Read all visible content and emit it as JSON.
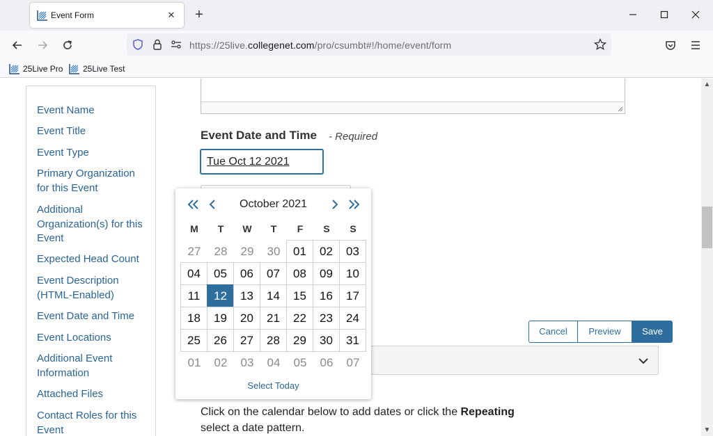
{
  "browser": {
    "tab_title": "Event Form",
    "url_prefix": "https://25live.",
    "url_domain": "collegenet.com",
    "url_path": "/pro/csumbt#!/home/event/form",
    "bookmarks": [
      {
        "label": "25Live Pro"
      },
      {
        "label": "25Live Test"
      }
    ]
  },
  "sidebar": {
    "items": [
      {
        "label": "Event Name"
      },
      {
        "label": "Event Title"
      },
      {
        "label": "Event Type"
      },
      {
        "label": "Primary Organization for this Event"
      },
      {
        "label": "Additional Organization(s) for this Event"
      },
      {
        "label": "Expected Head Count"
      },
      {
        "label": "Event Description (HTML-Enabled)"
      },
      {
        "label": "Event Date and Time"
      },
      {
        "label": "Event Locations"
      },
      {
        "label": "Additional Event Information"
      },
      {
        "label": "Attached Files"
      },
      {
        "label": "Contact Roles for this Event"
      }
    ]
  },
  "form": {
    "section_title": "Event Date and Time",
    "section_required": "- Required",
    "date_value": "Tue Oct 12 2021",
    "instructions_start": "Click on the calendar below to add dates or click the ",
    "instructions_bold": "Repeating",
    "instructions_end": "select a date pattern."
  },
  "actions": {
    "cancel": "Cancel",
    "preview": "Preview",
    "save": "Save"
  },
  "calendar": {
    "month_label": "October 2021",
    "weekdays": [
      "M",
      "T",
      "W",
      "T",
      "F",
      "S",
      "S"
    ],
    "weeks": [
      [
        "27",
        "28",
        "29",
        "30",
        "01",
        "02",
        "03"
      ],
      [
        "04",
        "05",
        "06",
        "07",
        "08",
        "09",
        "10"
      ],
      [
        "11",
        "12",
        "13",
        "14",
        "15",
        "16",
        "17"
      ],
      [
        "18",
        "19",
        "20",
        "21",
        "22",
        "23",
        "24"
      ],
      [
        "25",
        "26",
        "27",
        "28",
        "29",
        "30",
        "31"
      ],
      [
        "01",
        "02",
        "03",
        "04",
        "05",
        "06",
        "07"
      ]
    ],
    "selected_day": "12",
    "select_today": "Select Today"
  },
  "colors": {
    "accent": "#2e6e9e",
    "link": "#2a6496"
  }
}
